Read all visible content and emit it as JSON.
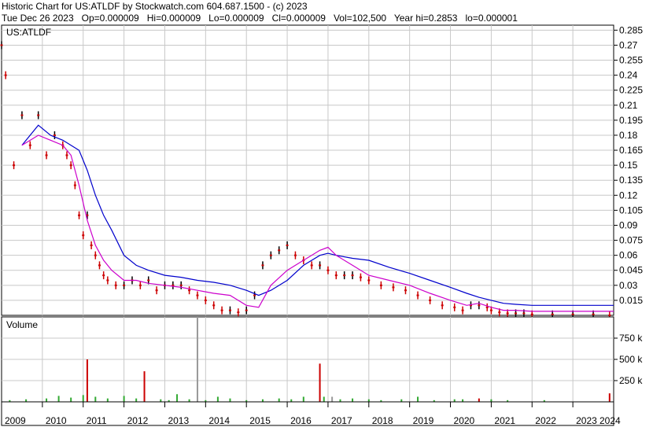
{
  "header": {
    "title": "Historic Chart for US:ATLDF by Stockwatch.com 604.687.1500 - (c) 2023",
    "date": "Tue Dec 26 2023",
    "open": "Op=0.000009",
    "high": "Hi=0.000009",
    "low": "Lo=0.000009",
    "close": "Cl=0.000009",
    "volume": "Vol=102,500",
    "year_high": "Year hi=0.2853",
    "year_low": "lo=0.000001"
  },
  "colors": {
    "price_bars": "#cc0000",
    "price_up_bars": "#000000",
    "ma_short": "#cc00cc",
    "ma_long": "#0000cc",
    "volume_up": "#33aa33",
    "volume_down": "#cc0000",
    "grid": "#c8c8c8"
  },
  "chart_data": [
    {
      "type": "line",
      "panel": "price",
      "label": "US:ATLDF",
      "y_ticks": [
        "0.285",
        "0.27",
        "0.255",
        "0.24",
        "0.225",
        "0.21",
        "0.195",
        "0.18",
        "0.165",
        "0.15",
        "0.135",
        "0.12",
        "0.105",
        "0.09",
        "0.075",
        "0.06",
        "0.045",
        "0.03",
        "0.015"
      ],
      "ylim": [
        0,
        0.29
      ],
      "x_ticks": [
        "2009",
        "2010",
        "2011",
        "2012",
        "2013",
        "2014",
        "2015",
        "2016",
        "2017",
        "2018",
        "2019",
        "2020",
        "2021",
        "2022",
        "2023",
        "2024"
      ],
      "xlim": [
        2009.0,
        2024.0
      ],
      "grid": true,
      "price_series": {
        "x": [
          2009.0,
          2009.1,
          2009.3,
          2009.5,
          2009.7,
          2009.9,
          2010.1,
          2010.3,
          2010.5,
          2010.6,
          2010.7,
          2010.8,
          2010.9,
          2011.0,
          2011.1,
          2011.2,
          2011.3,
          2011.4,
          2011.5,
          2011.6,
          2011.8,
          2012.0,
          2012.2,
          2012.4,
          2012.6,
          2012.8,
          2013.0,
          2013.2,
          2013.4,
          2013.6,
          2013.8,
          2014.0,
          2014.2,
          2014.4,
          2014.6,
          2014.8,
          2015.0,
          2015.2,
          2015.4,
          2015.6,
          2015.8,
          2016.0,
          2016.2,
          2016.4,
          2016.6,
          2016.8,
          2017.0,
          2017.2,
          2017.4,
          2017.6,
          2017.8,
          2018.0,
          2018.3,
          2018.6,
          2018.9,
          2019.2,
          2019.5,
          2019.8,
          2020.1,
          2020.3,
          2020.5,
          2020.7,
          2020.9,
          2021.0,
          2021.2,
          2021.4,
          2021.6,
          2021.8,
          2022.0,
          2022.5,
          2023.0,
          2023.5,
          2023.9
        ],
        "y": [
          0.27,
          0.24,
          0.15,
          0.2,
          0.17,
          0.2,
          0.16,
          0.18,
          0.17,
          0.16,
          0.15,
          0.13,
          0.1,
          0.08,
          0.1,
          0.07,
          0.06,
          0.05,
          0.04,
          0.035,
          0.03,
          0.03,
          0.035,
          0.03,
          0.035,
          0.025,
          0.03,
          0.03,
          0.03,
          0.025,
          0.02,
          0.015,
          0.01,
          0.005,
          0.005,
          0.003,
          0.005,
          0.02,
          0.05,
          0.06,
          0.065,
          0.07,
          0.06,
          0.055,
          0.05,
          0.05,
          0.045,
          0.04,
          0.04,
          0.04,
          0.038,
          0.035,
          0.03,
          0.028,
          0.025,
          0.02,
          0.015,
          0.01,
          0.008,
          0.005,
          0.01,
          0.01,
          0.008,
          0.005,
          0.003,
          0.002,
          0.002,
          0.002,
          0.001,
          0.001,
          0.001,
          0.001,
          9e-06
        ]
      },
      "series": [
        {
          "x": [
            2009.5,
            2009.9,
            2010.2,
            2010.5,
            2010.7,
            2010.9,
            2011.1,
            2011.3,
            2011.5,
            2011.7,
            2012.0,
            2012.3,
            2012.6,
            2013.0,
            2013.4,
            2013.8,
            2014.2,
            2014.6,
            2015.0,
            2015.3,
            2015.6,
            2016.0,
            2016.4,
            2016.8,
            2017.0,
            2017.2,
            2017.6,
            2018.0,
            2018.5,
            2019.0,
            2019.5,
            2020.0,
            2020.4,
            2020.7,
            2021.0,
            2021.3,
            2021.6,
            2022.0,
            2022.5,
            2023.0,
            2023.5,
            2024.0
          ],
          "y": [
            0.17,
            0.19,
            0.18,
            0.175,
            0.17,
            0.165,
            0.145,
            0.12,
            0.1,
            0.085,
            0.06,
            0.05,
            0.045,
            0.04,
            0.038,
            0.035,
            0.033,
            0.03,
            0.025,
            0.02,
            0.025,
            0.035,
            0.05,
            0.06,
            0.062,
            0.06,
            0.057,
            0.055,
            0.048,
            0.042,
            0.035,
            0.028,
            0.022,
            0.018,
            0.015,
            0.012,
            0.011,
            0.01,
            0.01,
            0.01,
            0.01,
            0.01
          ]
        },
        {
          "x": [
            2009.5,
            2009.9,
            2010.2,
            2010.5,
            2010.7,
            2010.9,
            2011.1,
            2011.3,
            2011.5,
            2011.7,
            2012.0,
            2012.3,
            2012.6,
            2013.0,
            2013.4,
            2013.8,
            2014.2,
            2014.6,
            2015.0,
            2015.3,
            2015.6,
            2016.0,
            2016.4,
            2016.8,
            2017.0,
            2017.2,
            2017.6,
            2018.0,
            2018.5,
            2019.0,
            2019.5,
            2020.0,
            2020.4,
            2020.7,
            2021.0,
            2021.3,
            2021.6,
            2022.0,
            2022.5,
            2023.0,
            2023.5,
            2024.0
          ],
          "y": [
            0.17,
            0.18,
            0.175,
            0.17,
            0.16,
            0.13,
            0.095,
            0.07,
            0.055,
            0.045,
            0.035,
            0.035,
            0.032,
            0.03,
            0.028,
            0.025,
            0.022,
            0.02,
            0.01,
            0.008,
            0.03,
            0.045,
            0.055,
            0.065,
            0.068,
            0.06,
            0.05,
            0.04,
            0.035,
            0.03,
            0.022,
            0.015,
            0.01,
            0.012,
            0.008,
            0.005,
            0.005,
            0.004,
            0.004,
            0.004,
            0.004,
            0.004
          ]
        }
      ]
    },
    {
      "type": "bar",
      "panel": "volume",
      "label": "Volume",
      "y_ticks": [
        "750 k",
        "500 k",
        "250 k"
      ],
      "ylim": [
        0,
        1000000
      ],
      "grid": true,
      "x": [
        2009.2,
        2009.6,
        2010.1,
        2010.4,
        2010.7,
        2011.0,
        2011.1,
        2011.3,
        2011.6,
        2012.0,
        2012.3,
        2012.5,
        2012.9,
        2013.1,
        2013.3,
        2013.6,
        2013.8,
        2014.0,
        2014.3,
        2014.6,
        2015.0,
        2015.4,
        2015.8,
        2016.1,
        2016.4,
        2016.8,
        2016.9,
        2017.1,
        2017.3,
        2017.6,
        2018.0,
        2018.3,
        2018.8,
        2019.2,
        2019.6,
        2020.1,
        2020.3,
        2020.7,
        2021.0,
        2021.4,
        2022.3,
        2023.9
      ],
      "values": [
        20000,
        30000,
        40000,
        70000,
        50000,
        80000,
        500000,
        60000,
        40000,
        70000,
        40000,
        360000,
        30000,
        20000,
        90000,
        30000,
        1000000,
        20000,
        60000,
        40000,
        20000,
        30000,
        40000,
        30000,
        60000,
        450000,
        60000,
        60000,
        30000,
        40000,
        30000,
        20000,
        30000,
        60000,
        20000,
        30000,
        30000,
        40000,
        30000,
        20000,
        20000,
        100000
      ],
      "colors": [
        "g",
        "g",
        "g",
        "g",
        "g",
        "g",
        "r",
        "g",
        "g",
        "g",
        "g",
        "r",
        "g",
        "g",
        "g",
        "g",
        "gray",
        "g",
        "g",
        "g",
        "g",
        "g",
        "g",
        "g",
        "g",
        "r",
        "g",
        "gray",
        "g",
        "g",
        "g",
        "g",
        "g",
        "g",
        "g",
        "g",
        "g",
        "r",
        "g",
        "g",
        "g",
        "r"
      ]
    }
  ]
}
